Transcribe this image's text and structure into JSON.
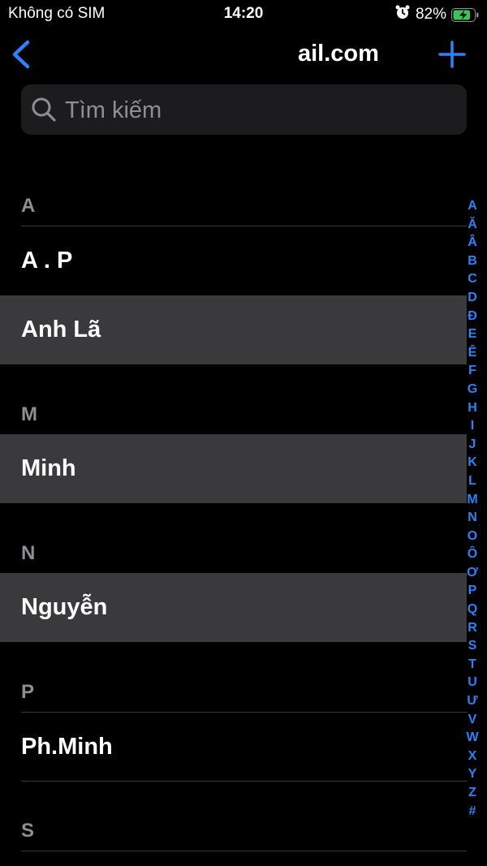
{
  "status_bar": {
    "carrier": "Không có SIM",
    "time": "14:20",
    "battery_percent": "82%",
    "battery_level": 0.82,
    "icons": [
      "alarm-icon",
      "battery-charging-icon"
    ]
  },
  "nav": {
    "title": "ail.com",
    "back_icon": "chevron-left-icon",
    "add_icon": "plus-icon"
  },
  "search": {
    "placeholder": "Tìm kiếm",
    "value": ""
  },
  "sections": [
    {
      "letter": "A",
      "contacts": [
        {
          "name": "A . P",
          "selected": false
        },
        {
          "name": "Anh Lã",
          "selected": true
        }
      ]
    },
    {
      "letter": "M",
      "contacts": [
        {
          "name": "Minh",
          "selected": true
        }
      ]
    },
    {
      "letter": "N",
      "contacts": [
        {
          "name": "Nguyễn",
          "selected": true
        }
      ]
    },
    {
      "letter": "P",
      "contacts": [
        {
          "name": "Ph.Minh",
          "selected": false
        }
      ]
    },
    {
      "letter": "S",
      "contacts": []
    }
  ],
  "index_letters": [
    "A",
    "Ă",
    "Â",
    "B",
    "C",
    "D",
    "Đ",
    "E",
    "Ê",
    "F",
    "G",
    "H",
    "I",
    "J",
    "K",
    "L",
    "M",
    "N",
    "O",
    "Ô",
    "Ơ",
    "P",
    "Q",
    "R",
    "S",
    "T",
    "U",
    "Ư",
    "V",
    "W",
    "X",
    "Y",
    "Z",
    "#"
  ],
  "colors": {
    "accent": "#2e82f7",
    "background": "#000000",
    "selected_row": "#3a3a3c",
    "search_bg": "#1c1c1e",
    "battery_green": "#34c759"
  }
}
